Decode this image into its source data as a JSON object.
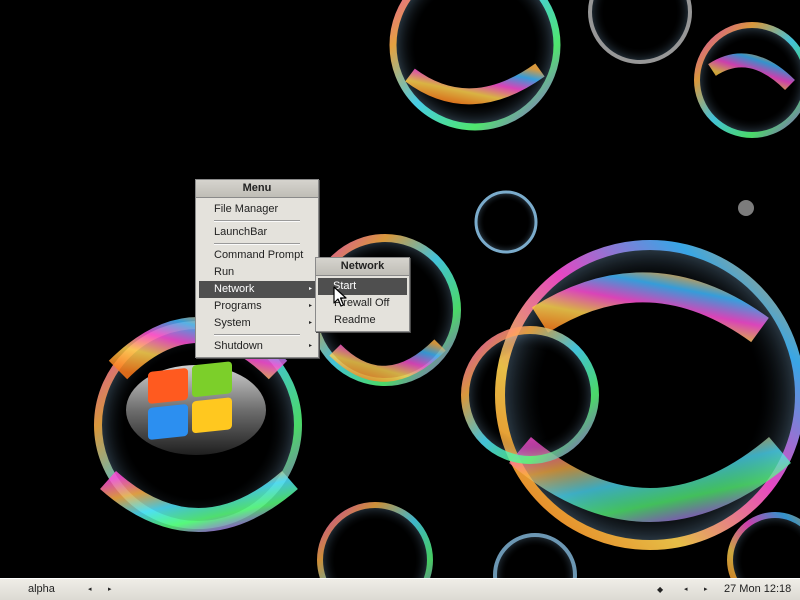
{
  "desktop": {
    "background_color": "#000000",
    "wallpaper_icon": "soap-bubbles-windows-logo-wallpaper"
  },
  "start_menu": {
    "title": "Menu",
    "items": {
      "file_manager": "File Manager",
      "launchbar": "LaunchBar",
      "command_prompt": "Command Prompt",
      "run": "Run",
      "network": "Network",
      "programs": "Programs",
      "system": "System",
      "shutdown": "Shutdown"
    },
    "active_item": "Network",
    "submenu_arrow": "▸"
  },
  "network_menu": {
    "title": "Network",
    "items": {
      "start": "Start",
      "firewall_off": "Firewall Off",
      "readme": "Readme"
    },
    "active_item": "Start"
  },
  "taskbar": {
    "workspace_name": "alpha",
    "prev_arrow": "◂",
    "next_arrow": "▸",
    "tray_indicator": "◆",
    "clock": "27 Mon 12:18"
  },
  "colors": {
    "menu_bg": "#e4e2dc",
    "menu_highlight": "#4f4f4f",
    "taskbar_bg": "#e6e4de"
  }
}
